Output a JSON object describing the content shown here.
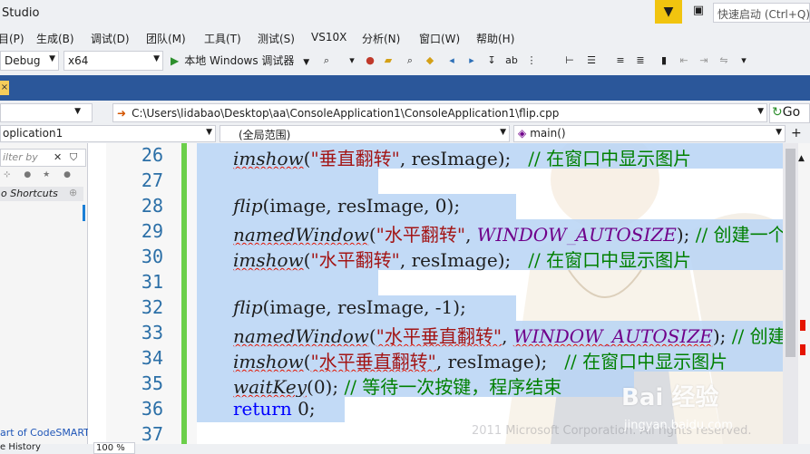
{
  "window": {
    "title": "Studio"
  },
  "titlebar": {
    "quick_launch_placeholder": "快速启动 (Ctrl+Q)"
  },
  "menu": [
    {
      "label": "目(P)",
      "key": "project"
    },
    {
      "label": "生成(B)",
      "key": "build"
    },
    {
      "label": "调试(D)",
      "key": "debug"
    },
    {
      "label": "团队(M)",
      "key": "team"
    },
    {
      "label": "工具(T)",
      "key": "tools"
    },
    {
      "label": "测试(S)",
      "key": "test"
    },
    {
      "label": "VS10X",
      "key": "vs10x"
    },
    {
      "label": "分析(N)",
      "key": "analyze"
    },
    {
      "label": "窗口(W)",
      "key": "window"
    },
    {
      "label": "帮助(H)",
      "key": "help"
    }
  ],
  "toolbar": {
    "configuration": "Debug",
    "platform": "x64",
    "run_label": "本地 Windows 调试器"
  },
  "navbar": {
    "path": "C:\\Users\\lidabao\\Desktop\\aa\\ConsoleApplication1\\ConsoleApplication1\\flip.cpp",
    "go_label": "Go",
    "project": "oplication1",
    "scope": "(全局范围)",
    "member": "main()"
  },
  "left_panel": {
    "filter_placeholder": "ilter by",
    "shortcuts_label": "o Shortcuts",
    "codesmart_link": "art of CodeSMART"
  },
  "bottom_bar": {
    "history_label": "e History",
    "zoom": "100 %"
  },
  "editor": {
    "lines": [
      {
        "n": "26",
        "sel_from": 160,
        "sel_to": 766
      },
      {
        "n": "27",
        "sel_from": 120,
        "sel_to": 766
      },
      {
        "n": "28",
        "sel_from": 120,
        "sel_to": 568
      },
      {
        "n": "29",
        "sel_from": 120,
        "sel_to": 766
      },
      {
        "n": "30",
        "sel_from": 120,
        "sel_to": 766
      },
      {
        "n": "31",
        "sel_from": 120,
        "sel_to": 766
      },
      {
        "n": "32",
        "sel_from": 120,
        "sel_to": 568
      },
      {
        "n": "33",
        "sel_from": 120,
        "sel_to": 766
      },
      {
        "n": "34",
        "sel_from": 120,
        "sel_to": 766
      },
      {
        "n": "35",
        "sel_from": 120,
        "sel_to": 696
      },
      {
        "n": "36",
        "sel_from": 120,
        "sel_to": 380
      },
      {
        "n": "37",
        "sel_from": 0,
        "sel_to": 0
      }
    ],
    "tokens": {
      "l26_fn": "imshow",
      "l26_open": "(",
      "l26_str": "\"垂直翻转\"",
      "l26_rest": ", resImage);",
      "l26_cmt": "   // 在窗口中显示图片",
      "l28_fn": "flip",
      "l28_rest": "(image, resImage, 0);",
      "l29_fn": "namedWindow",
      "l29_open": "(",
      "l29_str": "\"水平翻转\"",
      "l29_sep": ", ",
      "l29_mac": "WINDOW_AUTOSIZE",
      "l29_rest": "); ",
      "l29_cmt": "// 创建一个窗口",
      "l30_fn": "imshow",
      "l30_open": "(",
      "l30_str": "\"水平翻转\"",
      "l30_rest": ", resImage);",
      "l30_cmt": "   // 在窗口中显示图片",
      "l32_fn": "flip",
      "l32_rest": "(image, resImage, -1);",
      "l33_fn": "namedWindow",
      "l33_open": "(",
      "l33_str": "\"水平垂直翻转\"",
      "l33_sep": ", ",
      "l33_mac": "WINDOW_AUTOSIZE",
      "l33_rest": "); ",
      "l33_cmt": "// 创建一个窗口",
      "l34_fn": "imshow",
      "l34_open": "(",
      "l34_str": "\"水平垂直翻转\"",
      "l34_rest": ", resImage);",
      "l34_cmt": "   // 在窗口中显示图片",
      "l35_fn": "waitKey",
      "l35_rest": "(0); ",
      "l35_cmt": "// 等待一次按键，程序结束",
      "l36_kw": "return",
      "l36_rest": " 0;"
    }
  },
  "watermarks": {
    "baidu": "Bai 经验",
    "jingyan": "jingyan.baidu.com",
    "ms": "2011 Microsoft Corporation. All rights reserved."
  },
  "colors": {
    "accent_blue": "#2b579a",
    "selection": "#b7d3f5",
    "line_number": "#2b6fa7",
    "change_bar": "#6bcf4a",
    "string": "#a31515",
    "comment": "#008000",
    "keyword": "#0000ff",
    "macro": "#6f008a"
  }
}
